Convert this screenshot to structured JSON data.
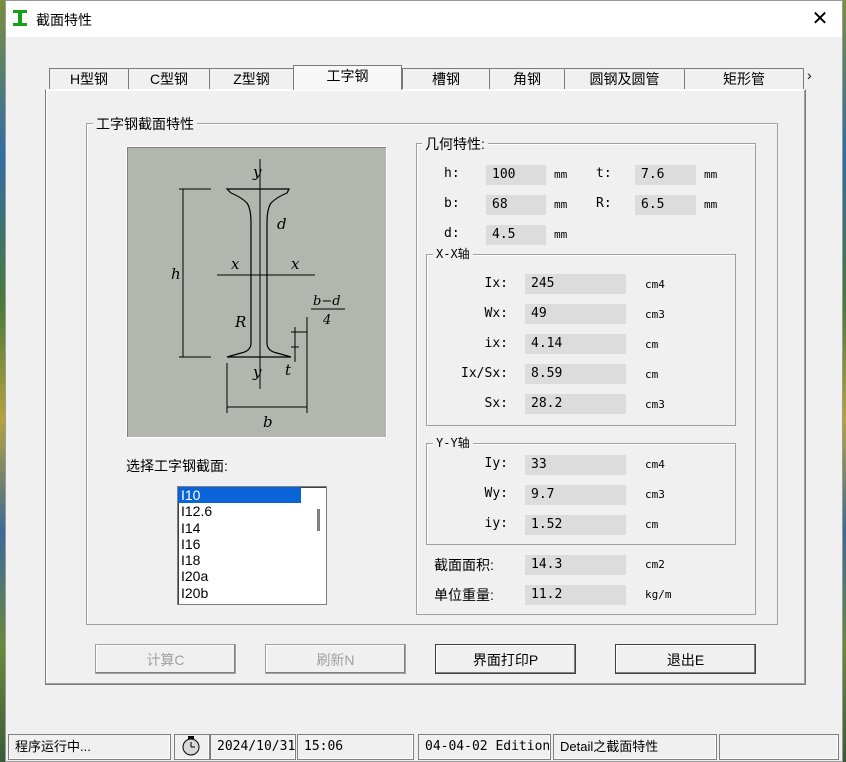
{
  "window": {
    "title": "截面特性",
    "close_glyph": "✕"
  },
  "tabs": [
    {
      "label": "H型钢"
    },
    {
      "label": "C型钢"
    },
    {
      "label": "Z型钢"
    },
    {
      "label": "工字钢"
    },
    {
      "label": "槽钢"
    },
    {
      "label": "角钢"
    },
    {
      "label": "圆钢及圆管"
    },
    {
      "label": "矩形管"
    }
  ],
  "active_tab": "工字钢",
  "section_group": {
    "title": "工字钢截面特性"
  },
  "diagram": {
    "labels": {
      "y_top": "y",
      "y_bottom": "y",
      "x_left": "x",
      "x_right": "x",
      "h": "h",
      "d": "d",
      "R": "R",
      "t": "t",
      "b": "b",
      "frac_num": "b−d",
      "frac_den": "4"
    }
  },
  "select_label": "选择工字钢截面:",
  "sections": [
    "I10",
    "I12.6",
    "I14",
    "I16",
    "I18",
    "I20a",
    "I20b"
  ],
  "selected_section": "I10",
  "geometry": {
    "title": "几何特性:",
    "h": {
      "label": "h:",
      "value": "100",
      "unit": "mm"
    },
    "t": {
      "label": "t:",
      "value": "7.6",
      "unit": "mm"
    },
    "b": {
      "label": "b:",
      "value": "68",
      "unit": "mm"
    },
    "R": {
      "label": "R:",
      "value": "6.5",
      "unit": "mm"
    },
    "d": {
      "label": "d:",
      "value": "4.5",
      "unit": "mm"
    }
  },
  "xx_axis": {
    "title": "X-X轴",
    "rows": [
      {
        "label": "Ix:",
        "value": "245",
        "unit": "cm4"
      },
      {
        "label": "Wx:",
        "value": "49",
        "unit": "cm3"
      },
      {
        "label": "ix:",
        "value": "4.14",
        "unit": "cm"
      },
      {
        "label": "Ix/Sx:",
        "value": "8.59",
        "unit": "cm"
      },
      {
        "label": "Sx:",
        "value": "28.2",
        "unit": "cm3"
      }
    ]
  },
  "yy_axis": {
    "title": "Y-Y轴",
    "rows": [
      {
        "label": "Iy:",
        "value": "33",
        "unit": "cm4"
      },
      {
        "label": "Wy:",
        "value": "9.7",
        "unit": "cm3"
      },
      {
        "label": "iy:",
        "value": "1.52",
        "unit": "cm"
      }
    ]
  },
  "area": {
    "label": "截面面积:",
    "value": "14.3",
    "unit": "cm2"
  },
  "weight": {
    "label": "单位重量:",
    "value": "11.2",
    "unit": "kg/m"
  },
  "buttons": {
    "calc": "计算C",
    "refresh": "刷新N",
    "print": "界面打印P",
    "exit": "退出E"
  },
  "status": {
    "running": "程序运行中...",
    "date": "2024/10/31",
    "time": "15:06",
    "edition": "04-04-02 Edition",
    "detail": "Detail之截面特性"
  }
}
